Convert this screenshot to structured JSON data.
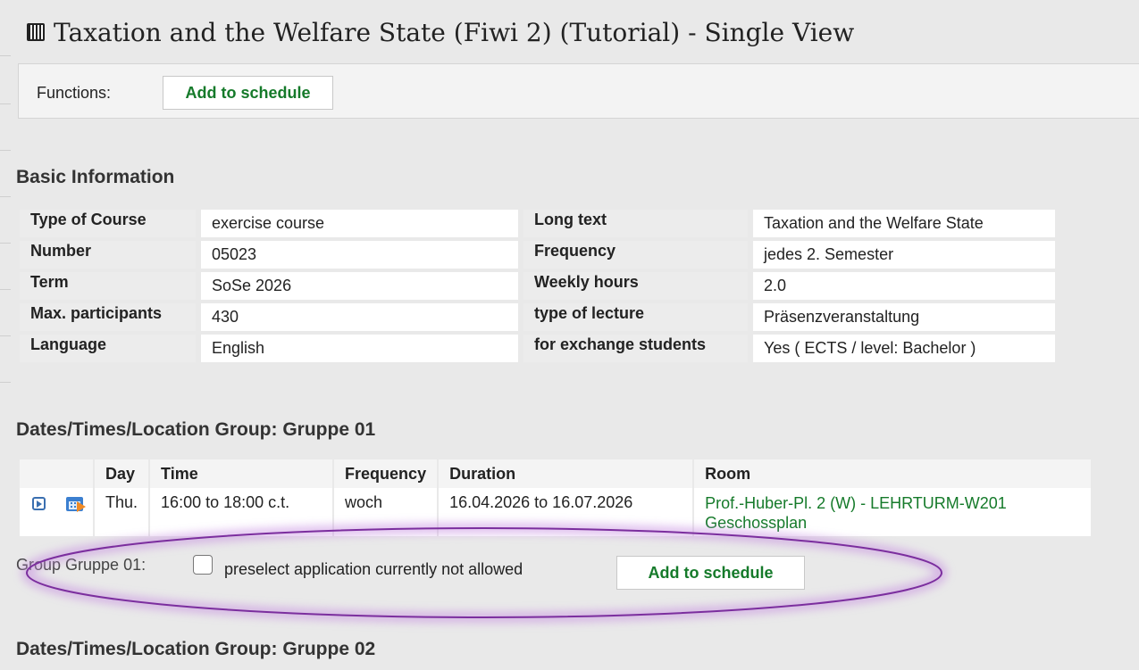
{
  "page": {
    "title": "Taxation and the Welfare State (Fiwi 2) (Tutorial) - Single View",
    "title_icon": "qr-code-icon"
  },
  "functions": {
    "label": "Functions:",
    "add_to_schedule": "Add to schedule"
  },
  "basic_information": {
    "heading": "Basic Information",
    "rows": [
      {
        "label1": "Type of Course",
        "value1": "exercise course",
        "label2": "Long text",
        "value2": "Taxation and the Welfare State"
      },
      {
        "label1": "Number",
        "value1": "05023",
        "label2": "Frequency",
        "value2": "jedes 2. Semester"
      },
      {
        "label1": "Term",
        "value1": "SoSe 2026",
        "label2": "Weekly hours",
        "value2": "2.0"
      },
      {
        "label1": "Max. participants",
        "value1": "430",
        "label2": "type of lecture",
        "value2": "Präsenzveranstaltung"
      },
      {
        "label1": "Language",
        "value1": "English",
        "label2": "for exchange students",
        "value2": "Yes  (  ECTS  /  level: Bachelor )"
      }
    ]
  },
  "group1": {
    "heading": "Dates/Times/Location Group: Gruppe 01",
    "columns": [
      "Day",
      "Time",
      "Frequency",
      "Duration",
      "Room"
    ],
    "row": {
      "day": "Thu.",
      "time": "16:00 to 18:00 c.t.",
      "frequency": "woch",
      "duration": "16.04.2026 to 16.07.2026",
      "room": "Prof.-Huber-Pl. 2 (W) - LEHRTURM-W201",
      "room_link": "Geschossplan"
    },
    "group_label": "Group Gruppe 01:",
    "preselect_text": "preselect  application currently not allowed",
    "add_to_schedule": "Add to schedule"
  },
  "group2": {
    "heading": "Dates/Times/Location Group: Gruppe 02"
  },
  "colors": {
    "link_green": "#157a2a",
    "highlight_purple": "#7b2e9e"
  }
}
